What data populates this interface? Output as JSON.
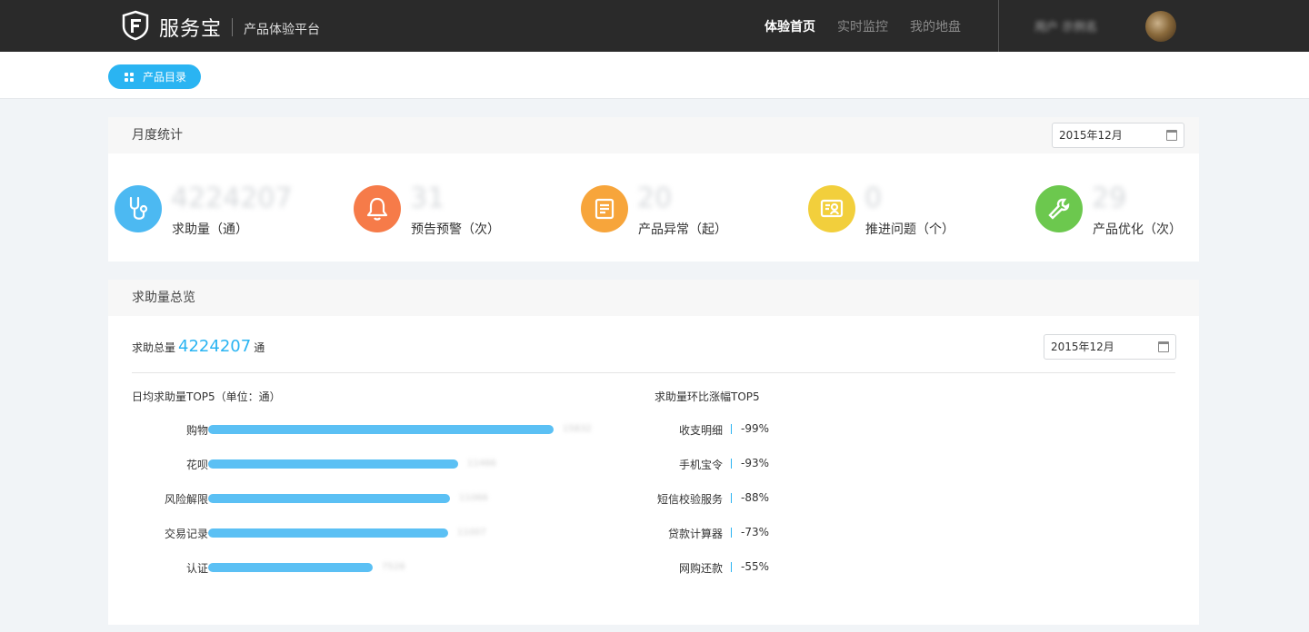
{
  "header": {
    "brand": "服务宝",
    "subtitle": "产品体验平台",
    "nav": [
      {
        "label": "体验首页",
        "active": true
      },
      {
        "label": "实时监控",
        "active": false
      },
      {
        "label": "我的地盘",
        "active": false
      }
    ],
    "user_name": "用户 示例名"
  },
  "subbar": {
    "catalog_label": "产品目录"
  },
  "monthly": {
    "title": "月度统计",
    "date": "2015年12月",
    "stats": [
      {
        "icon": "stethoscope-icon",
        "value": "4224207",
        "label": "求助量（通）",
        "color": "#4cb9f2"
      },
      {
        "icon": "bell-icon",
        "value": "31",
        "label": "预告预警（次）",
        "color": "#f67b49"
      },
      {
        "icon": "document-icon",
        "value": "20",
        "label": "产品异常（起）",
        "color": "#f7a53b"
      },
      {
        "icon": "id-card-icon",
        "value": "0",
        "label": "推进问题（个）",
        "color": "#f2cf3c"
      },
      {
        "icon": "wrench-icon",
        "value": "29",
        "label": "产品优化（次）",
        "color": "#6cc84e"
      }
    ]
  },
  "overview": {
    "title": "求助量总览",
    "total_prefix": "求助总量",
    "total_value": "4224207",
    "total_unit": "通",
    "date": "2015年12月",
    "top_daily": {
      "title": "日均求助量TOP5（单位：通）",
      "items": [
        {
          "label": "购物",
          "value": 15832,
          "value_text": "15832"
        },
        {
          "label": "花呗",
          "value": 11466,
          "value_text": "11466"
        },
        {
          "label": "风险解限",
          "value": 11066,
          "value_text": "11066"
        },
        {
          "label": "交易记录",
          "value": 11007,
          "value_text": "11007"
        },
        {
          "label": "认证",
          "value": 7528,
          "value_text": "7528"
        }
      ]
    },
    "top_growth": {
      "title": "求助量环比涨幅TOP5",
      "items": [
        {
          "label": "收支明细",
          "value": "-99%"
        },
        {
          "label": "手机宝令",
          "value": "-93%"
        },
        {
          "label": "短信校验服务",
          "value": "-88%"
        },
        {
          "label": "贷款计算器",
          "value": "-73%"
        },
        {
          "label": "网购还款",
          "value": "-55%"
        }
      ]
    }
  }
}
